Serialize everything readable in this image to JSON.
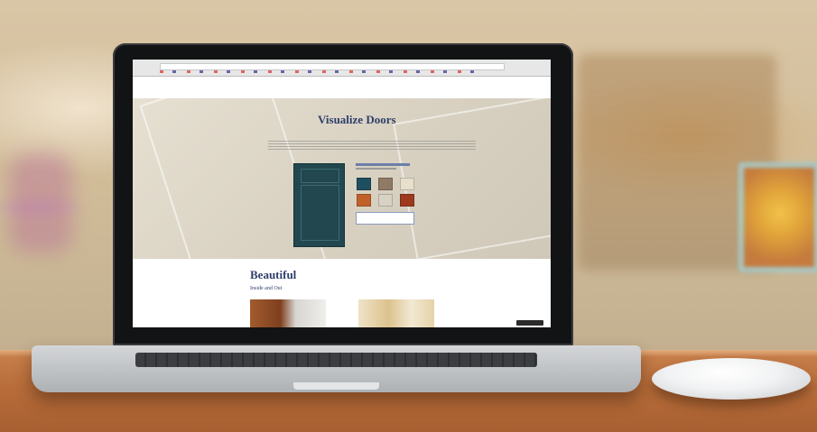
{
  "scene": {
    "description_colors": {
      "table": "#b86d3a",
      "background_blur": "#d2bd99",
      "laptop_body": "#c2c5c8",
      "bezel": "#121314"
    }
  },
  "website": {
    "nav": [
      "",
      "",
      "",
      "",
      "",
      ""
    ],
    "hero": {
      "title": "Visualize Doors",
      "cta_label": ""
    },
    "swatch_colors": [
      "#1f4e5f",
      "#8f7a66",
      "#e7dfcc",
      "#c0612b",
      "#d8d2c4",
      "#9c3a1f"
    ],
    "section": {
      "title": "Beautiful",
      "subtitle": "Inside and Out"
    }
  }
}
